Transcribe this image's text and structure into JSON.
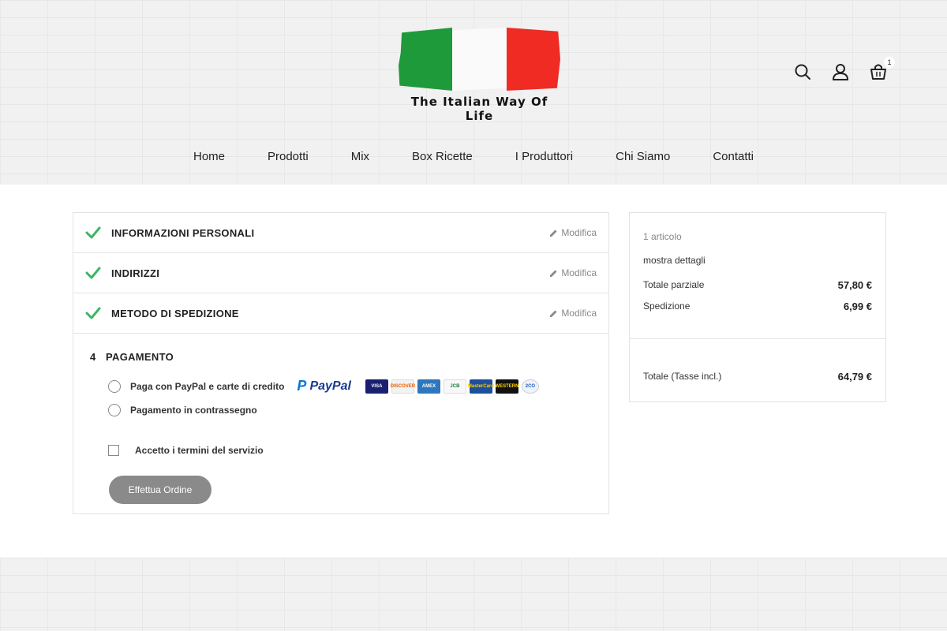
{
  "logo": {
    "text": "The Italian Way Of Life"
  },
  "header": {
    "cart_count": "1"
  },
  "nav": {
    "items": [
      "Home",
      "Prodotti",
      "Mix",
      "Box Ricette",
      "I Produttori",
      "Chi Siamo",
      "Contatti"
    ]
  },
  "checkout": {
    "steps": [
      {
        "title": "INFORMAZIONI PERSONALI",
        "edit": "Modifica"
      },
      {
        "title": "INDIRIZZI",
        "edit": "Modifica"
      },
      {
        "title": "METODO DI SPEDIZIONE",
        "edit": "Modifica"
      }
    ],
    "payment": {
      "number": "4",
      "title": "PAGAMENTO",
      "option_paypal": "Paga con PayPal e carte di credito",
      "paypal_logo": "PayPal",
      "cards": [
        "VISA",
        "DISCOVER",
        "AMEX",
        "JCB",
        "MasterCard",
        "WESTERN",
        "2CO"
      ],
      "option_cod": "Pagamento in contrassegno",
      "terms": "Accetto i termini del servizio",
      "order_button": "Effettua Ordine"
    }
  },
  "summary": {
    "items_count": "1 articolo",
    "details_link": "mostra dettagli",
    "subtotal_label": "Totale parziale",
    "subtotal_value": "57,80 €",
    "shipping_label": "Spedizione",
    "shipping_value": "6,99 €",
    "total_label": "Totale (Tasse incl.)",
    "total_value": "64,79 €"
  },
  "colors": {
    "check_green": "#3cb664",
    "button_gray": "#8a8a8a"
  }
}
